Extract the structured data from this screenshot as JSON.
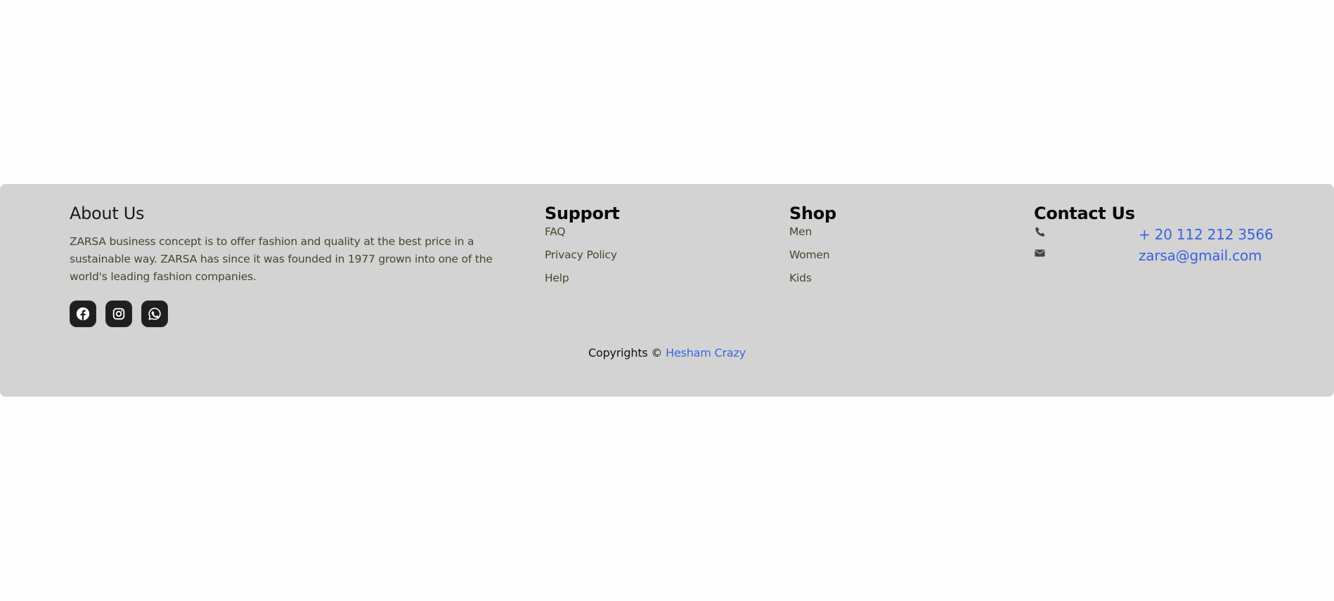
{
  "footer": {
    "about": {
      "title": "About Us",
      "text": "ZARSA business concept is to offer fashion and quality at the best price in a sustainable way. ZARSA has since it was founded in 1977 grown into one of the world's leading fashion companies.",
      "socials": [
        {
          "icon": "facebook-icon"
        },
        {
          "icon": "instagram-icon"
        },
        {
          "icon": "whatsapp-icon"
        }
      ]
    },
    "support": {
      "title": "Support",
      "links": [
        "FAQ",
        "Privacy Policy",
        "Help"
      ]
    },
    "shop": {
      "title": "Shop",
      "links": [
        "Men",
        "Women",
        "Kids"
      ]
    },
    "contact": {
      "title": "Contact Us",
      "phone_icon": "phone-icon",
      "email_icon": "envelope-icon",
      "phone": "+ 20 112 212 3566",
      "email": "zarsa@gmail.com"
    },
    "copyright": {
      "prefix": "Copyrights ©",
      "author": "Hesham Crazy"
    },
    "colors": {
      "background": "#d3d3d3",
      "link_accent": "#3a62e0",
      "icon_tile": "#1f1f1f"
    }
  }
}
